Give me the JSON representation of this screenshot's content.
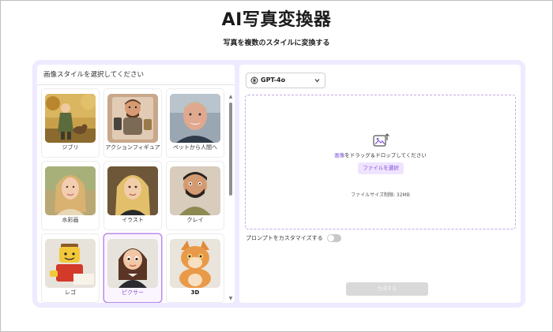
{
  "header": {
    "title": "AI写真変換器",
    "subtitle": "写真を複数のスタイルに変換する"
  },
  "style_panel": {
    "heading": "画像スタイルを選択してください",
    "selected": "ピクサー",
    "styles": [
      {
        "label": "ジブリ"
      },
      {
        "label": "アクションフィギュア"
      },
      {
        "label": "ペットから人間へ"
      },
      {
        "label": "水彩画"
      },
      {
        "label": "イラスト"
      },
      {
        "label": "クレイ"
      },
      {
        "label": "レゴ"
      },
      {
        "label": "ピクサー"
      },
      {
        "label": "3D"
      }
    ]
  },
  "upload_panel": {
    "model": "GPT-4o",
    "drop_highlight": "画像",
    "drop_text": "をドラッグ＆ドロップしてください",
    "file_button": "ファイルを選択",
    "size_limit": "ファイルサイズ制限: 32MB",
    "prompt_toggle_label": "プロンプトをカスタマイズする",
    "prompt_toggle_on": false,
    "generate_button": "生成する"
  },
  "colors": {
    "accent": "#7b4fd6",
    "panel_bg": "#eeeaff",
    "dashed_border": "#c6a9e8"
  }
}
